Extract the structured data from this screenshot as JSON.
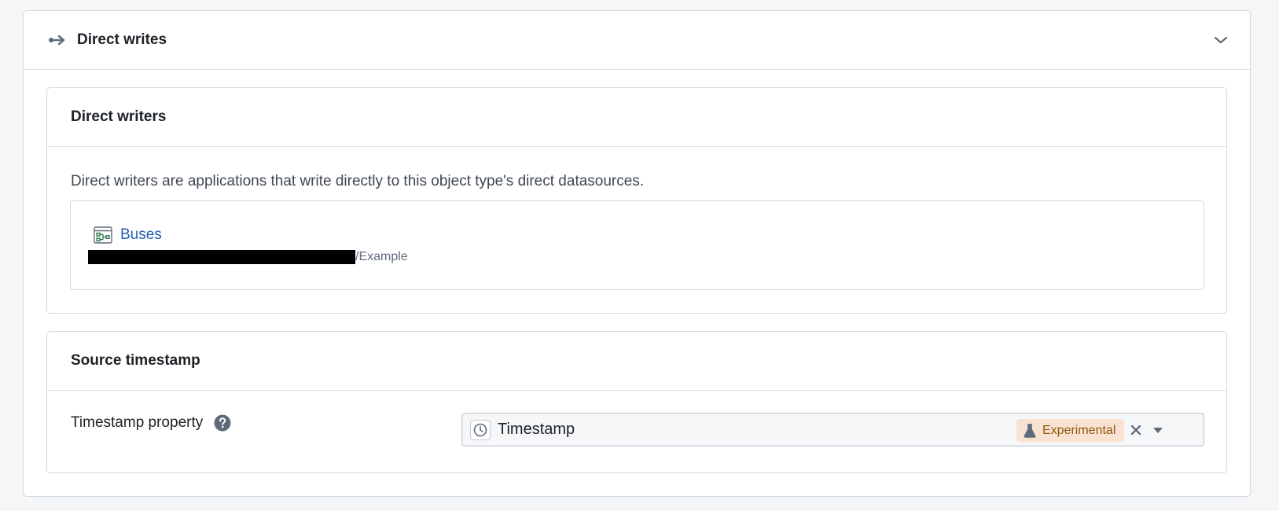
{
  "panel": {
    "title": "Direct writes",
    "header_icon": "arrow-right-icon",
    "collapse_icon": "chevron-down-icon"
  },
  "direct_writers": {
    "title": "Direct writers",
    "description": "Direct writers are applications that write directly to this object type's direct datasources.",
    "writers": [
      {
        "name": "Buses",
        "icon": "application-icon",
        "path_visible": "/Example",
        "path_redacted": true
      }
    ]
  },
  "source_timestamp": {
    "title": "Source timestamp",
    "property_label": "Timestamp property",
    "help_icon": "help-circle-icon",
    "select": {
      "value": "Timestamp",
      "value_icon": "clock-icon",
      "tag": "Experimental",
      "tag_icon": "flask-icon",
      "clear_icon": "close-icon",
      "caret_icon": "caret-down-icon"
    }
  },
  "colors": {
    "link": "#215db0",
    "tag_bg": "#f8e3d3",
    "tag_text": "#935610",
    "border": "#d3d8de"
  }
}
